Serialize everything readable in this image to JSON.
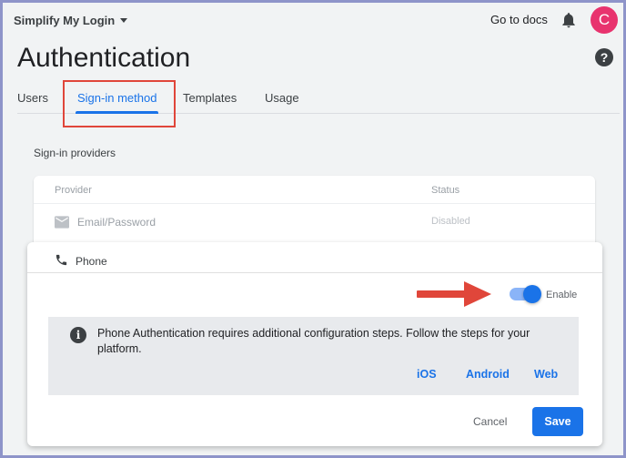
{
  "header": {
    "project_name": "Simplify My Login",
    "go_to_docs": "Go to docs",
    "avatar_initial": "C",
    "avatar_color": "#e8336e"
  },
  "page": {
    "title": "Authentication",
    "help_label": "?"
  },
  "tabs": [
    {
      "label": "Users",
      "active": false
    },
    {
      "label": "Sign-in method",
      "active": true
    },
    {
      "label": "Templates",
      "active": false
    },
    {
      "label": "Usage",
      "active": false
    }
  ],
  "providers": {
    "section_label": "Sign-in providers",
    "col_provider": "Provider",
    "col_status": "Status",
    "rows": [
      {
        "name": "Email/Password",
        "status": "Disabled",
        "icon": "email-icon"
      }
    ]
  },
  "phone_panel": {
    "name": "Phone",
    "icon": "phone-icon",
    "enable_label": "Enable",
    "enabled": true,
    "info_text": "Phone Authentication requires additional configuration steps. Follow the steps for your platform.",
    "info_icon": "i",
    "platforms": [
      "iOS",
      "Android",
      "Web"
    ],
    "cancel_label": "Cancel",
    "save_label": "Save"
  },
  "colors": {
    "accent": "#1a73e8",
    "annotation": "#e0463a"
  }
}
